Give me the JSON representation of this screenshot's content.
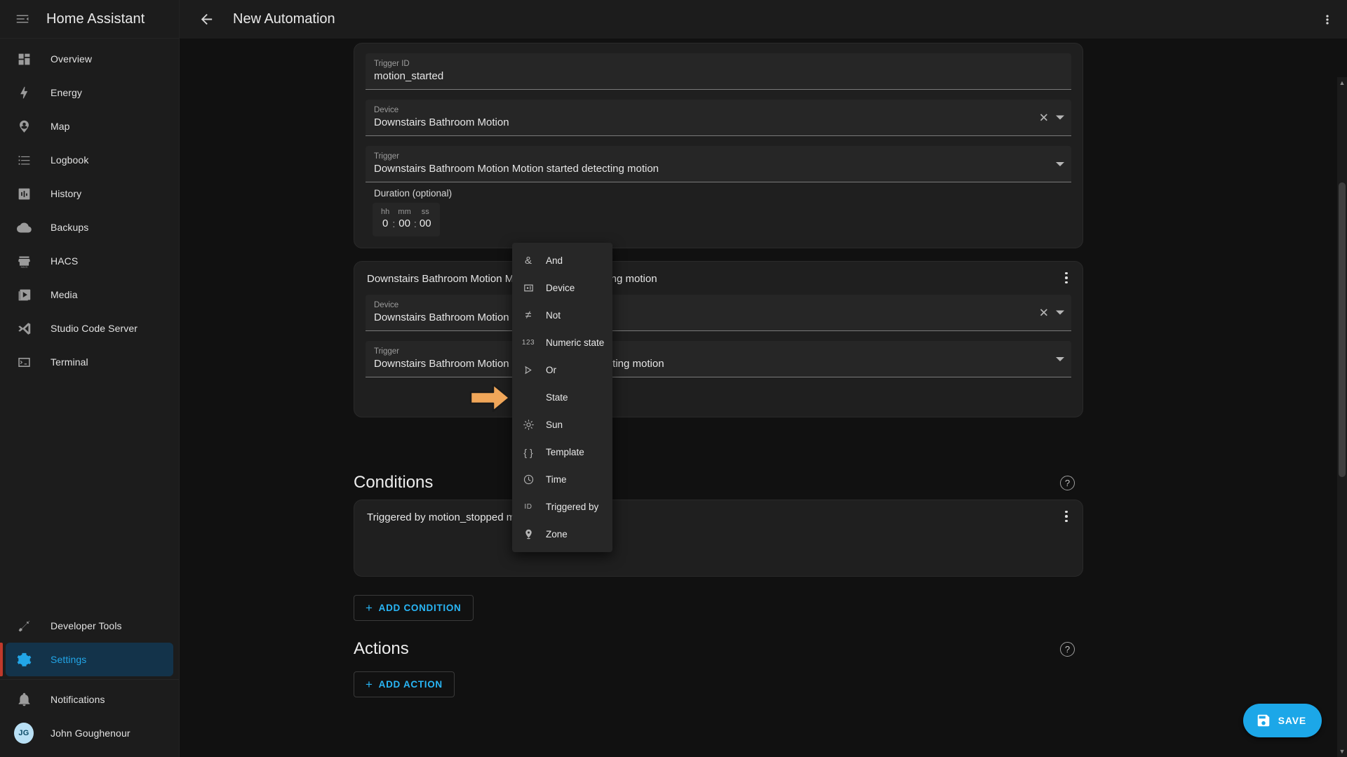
{
  "app": {
    "name": "Home Assistant",
    "user": {
      "initials": "JG",
      "name": "John Goughenour"
    }
  },
  "sidebar": {
    "items": [
      {
        "label": "Overview",
        "icon": "view-dashboard-icon",
        "active": false
      },
      {
        "label": "Energy",
        "icon": "lightning-bolt-icon",
        "active": false
      },
      {
        "label": "Map",
        "icon": "map-marker-account-icon",
        "active": false
      },
      {
        "label": "Logbook",
        "icon": "format-list-bulleted-icon",
        "active": false
      },
      {
        "label": "History",
        "icon": "chart-box-icon",
        "active": false
      },
      {
        "label": "Backups",
        "icon": "cloud-upload-icon",
        "active": false
      },
      {
        "label": "HACS",
        "icon": "storefront-icon",
        "active": false
      },
      {
        "label": "Media",
        "icon": "play-box-icon",
        "active": false
      },
      {
        "label": "Studio Code Server",
        "icon": "vscode-icon",
        "active": false
      },
      {
        "label": "Terminal",
        "icon": "console-icon",
        "active": false
      }
    ],
    "bottom": [
      {
        "label": "Developer Tools",
        "icon": "hammer-icon",
        "active": false
      },
      {
        "label": "Settings",
        "icon": "cog-icon",
        "active": true
      }
    ],
    "notifications": {
      "label": "Notifications",
      "icon": "bell-icon"
    }
  },
  "topbar": {
    "back_icon": "arrow-left-icon",
    "title": "New Automation",
    "overflow_icon": "dots-vertical-icon"
  },
  "trigger_card": {
    "trigger_id": {
      "label": "Trigger ID",
      "value": "motion_started"
    },
    "device": {
      "label": "Device",
      "value": "Downstairs Bathroom Motion"
    },
    "trigger": {
      "label": "Trigger",
      "value": "Downstairs Bathroom Motion Motion started detecting motion"
    },
    "duration": {
      "label": "Duration (optional)",
      "segments": [
        {
          "unit": "hh",
          "value": "0"
        },
        {
          "unit": "mm",
          "value": "00"
        },
        {
          "unit": "ss",
          "value": "00"
        }
      ]
    }
  },
  "trigger_card_2": {
    "headline": "Downstairs Bathroom Motion Motion stopped detecting motion",
    "device": {
      "label": "Device",
      "value": "Downstairs Bathroom Motion"
    },
    "trigger": {
      "label": "Trigger",
      "value": "Downstairs Bathroom Motion Motion stopped detecting motion"
    }
  },
  "conditions": {
    "title": "Conditions",
    "help_icon": "help-circle-icon",
    "card_headline": "Triggered by motion_stopped matches",
    "add_button": {
      "label": "ADD CONDITION",
      "plus": "+"
    }
  },
  "actions": {
    "title": "Actions",
    "help_icon": "help-circle-icon",
    "add_button": {
      "label": "ADD ACTION",
      "plus": "+"
    }
  },
  "save_fab": {
    "label": "SAVE",
    "icon": "content-save-icon",
    "color": "#1ca7e8"
  },
  "condition_menu": {
    "highlighted": "State",
    "pointer_color": "#f0a659",
    "items": [
      {
        "label": "And",
        "icon": "ampersand-icon",
        "glyph": "&"
      },
      {
        "label": "Device",
        "icon": "device-icon",
        "glyph": ""
      },
      {
        "label": "Not",
        "icon": "not-equal-icon",
        "glyph": "≠"
      },
      {
        "label": "Numeric state",
        "icon": "numeric-icon",
        "glyph": "123"
      },
      {
        "label": "Or",
        "icon": "logic-or-icon",
        "glyph": ""
      },
      {
        "label": "State",
        "icon": "state-icon",
        "glyph": ""
      },
      {
        "label": "Sun",
        "icon": "sun-icon",
        "glyph": ""
      },
      {
        "label": "Template",
        "icon": "code-braces-icon",
        "glyph": "{}"
      },
      {
        "label": "Time",
        "icon": "clock-icon",
        "glyph": ""
      },
      {
        "label": "Triggered by",
        "icon": "id-icon",
        "glyph": "ID"
      },
      {
        "label": "Zone",
        "icon": "map-marker-icon",
        "glyph": ""
      }
    ]
  },
  "colors": {
    "accent": "#1ca7e8",
    "sidebar_bg": "#1c1c1c",
    "page_bg": "#111111",
    "card_bg": "#1f1f1f",
    "field_bg": "#262626",
    "active_nav": "#22a6e8"
  }
}
